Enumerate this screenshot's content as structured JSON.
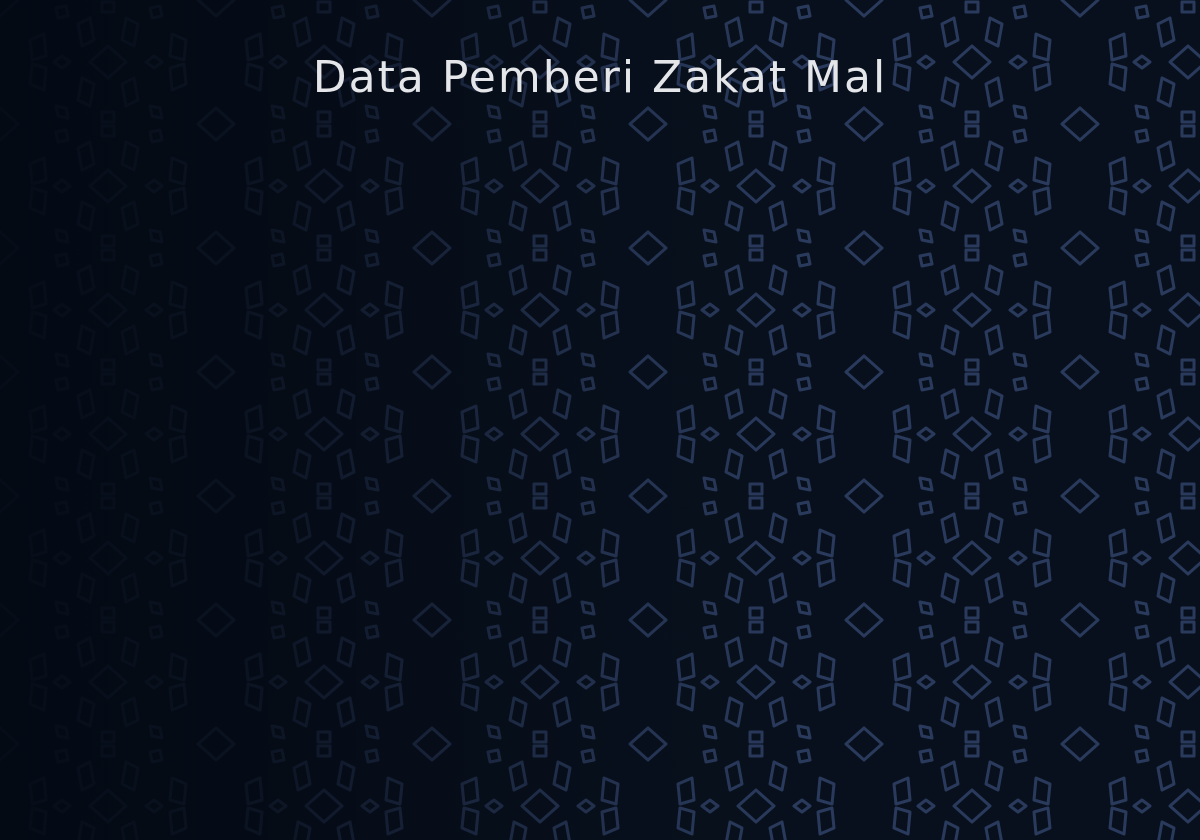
{
  "header": {
    "title": "Data Pemberi Zakat Mal"
  },
  "theme": {
    "background": "#08101d",
    "pattern_color": "#2a3a5c",
    "title_color": "#e4e6ea"
  },
  "decorations": {
    "background_pattern": "geometric-diamond-pattern"
  }
}
